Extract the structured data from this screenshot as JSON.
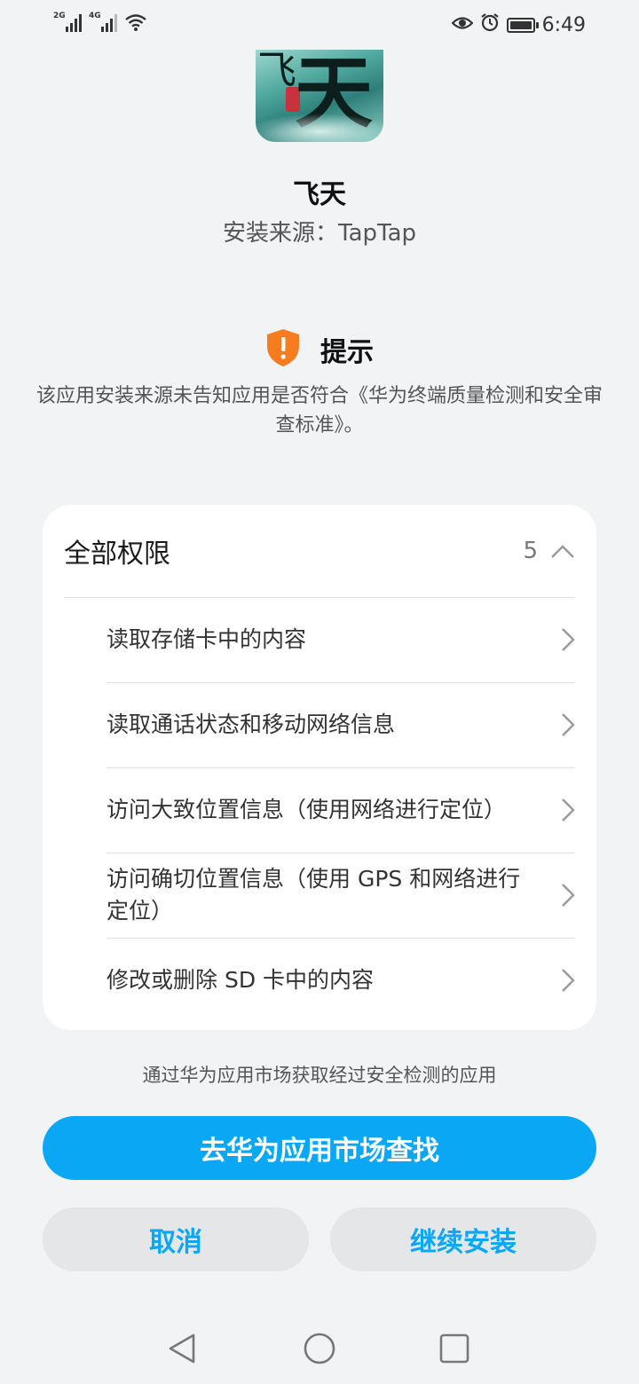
{
  "status_bar": {
    "sim1_tag": "2G",
    "sim2_tag": "4G",
    "time": "6:49",
    "icons": [
      "signal-icon",
      "signal-icon",
      "wifi-icon",
      "eye-icon",
      "alarm-icon",
      "battery-icon"
    ]
  },
  "app": {
    "name": "飞天",
    "install_source": "安装来源：TapTap",
    "icon_glyph": "天",
    "icon_glyph_left": "飞"
  },
  "warning": {
    "icon": "shield-warning-icon",
    "title": "提示",
    "text": "该应用安装来源未告知应用是否符合《华为终端质量检测和安全审查标准》。"
  },
  "permissions": {
    "title": "全部权限",
    "count": "5",
    "items": [
      {
        "label": "读取存储卡中的内容"
      },
      {
        "label": "读取通话状态和移动网络信息"
      },
      {
        "label": "访问大致位置信息（使用网络进行定位）"
      },
      {
        "label": "访问确切位置信息（使用 GPS 和网络进行定位）"
      },
      {
        "label": "修改或删除 SD 卡中的内容"
      }
    ]
  },
  "market_hint": "通过华为应用市场获取经过安全检测的应用",
  "buttons": {
    "market": "去华为应用市场查找",
    "cancel": "取消",
    "continue": "继续安装"
  },
  "colors": {
    "accent": "#0aa7f5",
    "warning": "#f57c1f",
    "background": "#f1f3f5"
  }
}
